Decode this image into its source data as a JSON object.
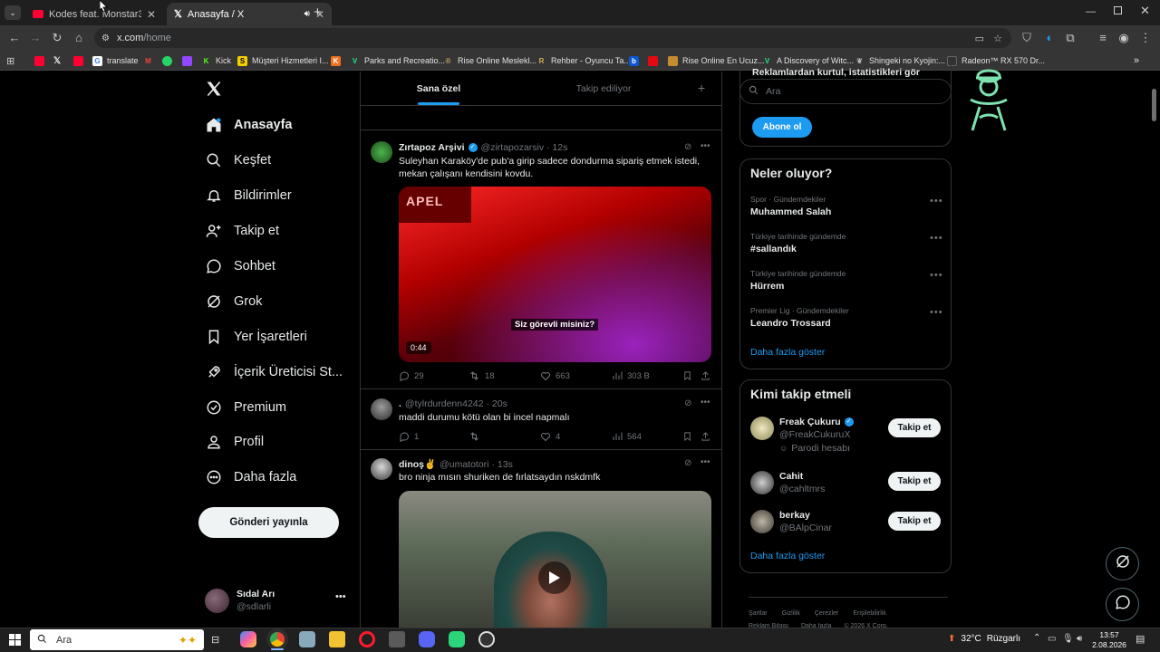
{
  "browser": {
    "tabs": [
      {
        "title": "Kodes feat. Monstar361 - Yeralt",
        "active": false
      },
      {
        "title": "Anasayfa / X",
        "active": true
      }
    ],
    "url_host": "x.com",
    "url_path": "/home",
    "bookmarks": [
      "translate",
      "Kick",
      "Müşteri Hizmetleri I...",
      "Parks and Recreatio...",
      "Rise Online Meslekl...",
      "Rehber - Oyuncu Ta...",
      "Rise Online En Ucuz...",
      "A Discovery of Witc...",
      "Shingeki no Kyojin:...",
      "Radeon™ RX 570 Dr..."
    ]
  },
  "sidebar": {
    "items": [
      {
        "label": "Anasayfa",
        "icon": "home-icon"
      },
      {
        "label": "Keşfet",
        "icon": "search-icon"
      },
      {
        "label": "Bildirimler",
        "icon": "bell-icon"
      },
      {
        "label": "Takip et",
        "icon": "follow-icon"
      },
      {
        "label": "Sohbet",
        "icon": "chat-icon"
      },
      {
        "label": "Grok",
        "icon": "grok-icon"
      },
      {
        "label": "Yer İşaretleri",
        "icon": "bookmark-icon"
      },
      {
        "label": "İçerik Üreticisi St...",
        "icon": "rocket-icon"
      },
      {
        "label": "Premium",
        "icon": "verified-icon"
      },
      {
        "label": "Profil",
        "icon": "profile-icon"
      },
      {
        "label": "Daha fazla",
        "icon": "more-icon"
      }
    ],
    "post_button": "Gönderi yayınla",
    "account": {
      "name": "Sıdal Arı",
      "handle": "@sdlarli"
    }
  },
  "feed": {
    "tabs": [
      "Sana özel",
      "Takip ediliyor"
    ],
    "posts": [
      {
        "name": "Zırtapoz Arşivi",
        "handle": "@zirtapozarsiv",
        "time": "· 12s",
        "text": "Suleyhan Karaköy'de pub'a girip sadece dondurma sipariş etmek istedi, mekan çalışanı kendisini kovdu.",
        "video_caption": "Siz görevli misiniz?",
        "video_duration": "0:44",
        "replies": "29",
        "reposts": "18",
        "likes": "663",
        "views": "303 B"
      },
      {
        "name": ".",
        "handle": "@tylrdurdenn4242",
        "time": "· 20s",
        "text": "maddi durumu kötü olan bi incel napmalı",
        "replies": "1",
        "reposts": "",
        "likes": "4",
        "views": "564"
      },
      {
        "name": "dinoş✌️",
        "handle": "@umatotori",
        "time": "· 13s",
        "text": "bro ninja mısın shuriken de fırlatsaydın nskdmfk"
      }
    ]
  },
  "right": {
    "search_placeholder": "Ara",
    "top_partial": "Reklamlardan kurtul, istatistikleri gör",
    "subscribe_button": "Abone ol",
    "trends_title": "Neler oluyor?",
    "trends": [
      {
        "meta": "Spor · Gündemdekiler",
        "name": "Muhammed Salah"
      },
      {
        "meta": "Türkiye tarihinde gündemde",
        "name": "#sallandık"
      },
      {
        "meta": "Türkiye tarihinde gündemde",
        "name": "Hürrem"
      },
      {
        "meta": "Premier Lig · Gündemdekiler",
        "name": "Leandro Trossard"
      }
    ],
    "show_more": "Daha fazla göster",
    "follow_title": "Kimi takip etmeli",
    "follow": [
      {
        "name": "Freak Çukuru",
        "handle": "@FreakCukuruX",
        "note": "Parodi hesabı",
        "verified": true
      },
      {
        "name": "Cahit",
        "handle": "@cahltmrs",
        "note": "",
        "verified": false
      },
      {
        "name": "berkay",
        "handle": "@BAlpCinar",
        "note": "",
        "verified": false
      }
    ],
    "follow_button": "Takip et",
    "footer": [
      "Şartlar",
      "Gizlilik",
      "Çerezler",
      "Erişilebilirlik"
    ],
    "footer2": [
      "Reklam Bilgisi",
      "Daha fazla",
      "© 2026 X Corp."
    ]
  },
  "taskbar": {
    "search": "Ara",
    "weather": "32°C",
    "weather_label": "Rüzgarlı",
    "time": "13:57",
    "date": "2.08.2026"
  },
  "colors": {
    "accent": "#1d9bf0",
    "bg": "#000000",
    "border": "#2f3336"
  }
}
